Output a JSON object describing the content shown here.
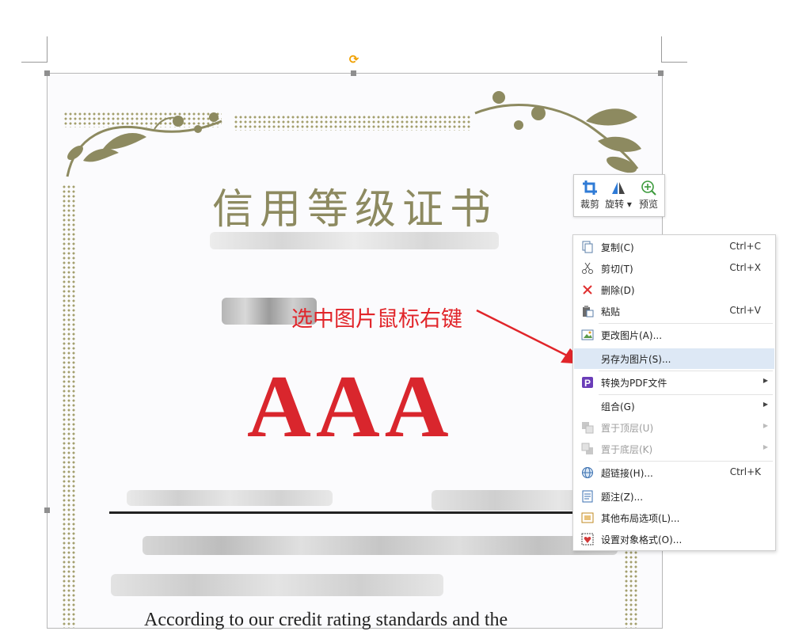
{
  "certificate": {
    "title": "信用等级证书",
    "grade": "AAA",
    "english_line": "According to our credit rating standards and the"
  },
  "annotation": {
    "text": "选中图片鼠标右键",
    "color": "#e1252a"
  },
  "mini_toolbar": {
    "crop_label": "裁剪",
    "rotate_label": "旋转",
    "preview_label": "预览"
  },
  "context_menu": {
    "items": [
      {
        "icon": "copy-icon",
        "label": "复制(C)",
        "shortcut": "Ctrl+C"
      },
      {
        "icon": "scissors-icon",
        "label": "剪切(T)",
        "shortcut": "Ctrl+X"
      },
      {
        "icon": "delete-x-icon",
        "label": "删除(D)",
        "shortcut": ""
      },
      {
        "icon": "paste-icon",
        "label": "粘贴",
        "shortcut": "Ctrl+V"
      },
      {
        "icon": "change-picture-icon",
        "label": "更改图片(A)...",
        "shortcut": ""
      },
      {
        "icon": "",
        "label": "另存为图片(S)...",
        "shortcut": "",
        "highlighted": true
      },
      {
        "icon": "pdf-icon",
        "label": "转换为PDF文件",
        "shortcut": "",
        "submenu": true
      },
      {
        "icon": "",
        "label": "组合(G)",
        "shortcut": "",
        "submenu": true
      },
      {
        "icon": "bring-front-icon",
        "label": "置于顶层(U)",
        "shortcut": "",
        "submenu": true,
        "disabled": true
      },
      {
        "icon": "send-back-icon",
        "label": "置于底层(K)",
        "shortcut": "",
        "submenu": true,
        "disabled": true
      },
      {
        "icon": "hyperlink-icon",
        "label": "超链接(H)...",
        "shortcut": "Ctrl+K"
      },
      {
        "icon": "caption-icon",
        "label": "题注(Z)...",
        "shortcut": ""
      },
      {
        "icon": "layout-options-icon",
        "label": "其他布局选项(L)...",
        "shortcut": ""
      },
      {
        "icon": "format-object-icon",
        "label": "设置对象格式(O)...",
        "shortcut": ""
      }
    ]
  },
  "colors": {
    "menu_highlight": "#dde8f5",
    "certificate_gold": "#8d8a60",
    "grade_red": "#d9262d"
  }
}
